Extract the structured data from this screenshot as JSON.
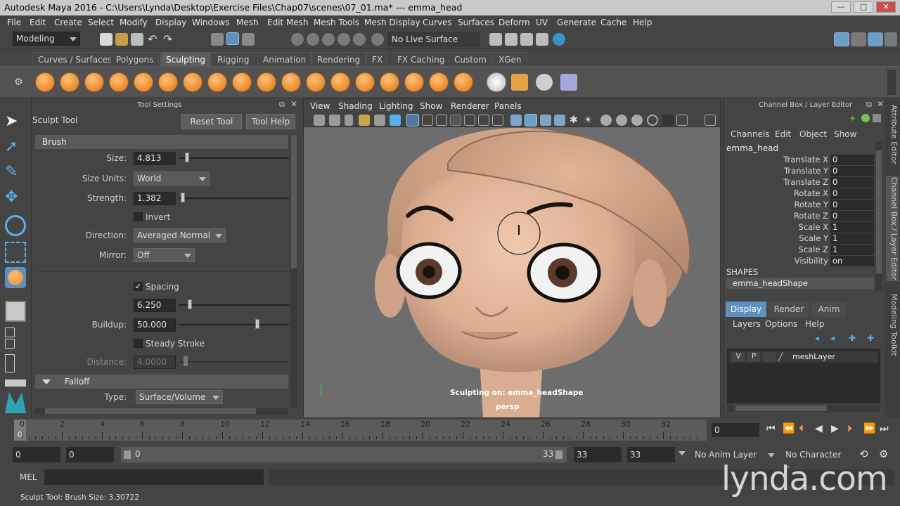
{
  "titlebar": {
    "title": "Autodesk Maya 2016 - C:\\Users\\Lynda\\Desktop\\Exercise Files\\Chap07\\scenes\\07_01.ma*  ---  emma_head",
    "min": "—",
    "max": "□",
    "close": "✕"
  },
  "menubar": [
    "File",
    "Edit",
    "Create",
    "Select",
    "Modify",
    "Display",
    "Windows",
    "Mesh",
    "Edit Mesh",
    "Mesh Tools",
    "Mesh Display",
    "Curves",
    "Surfaces",
    "Deform",
    "UV",
    "Generate",
    "Cache",
    "Help"
  ],
  "statusline": {
    "menuset": "Modeling",
    "live_surface": "No Live Surface"
  },
  "shelf_tabs": [
    "Curves / Surfaces",
    "Polygons",
    "Sculpting",
    "Rigging",
    "Animation",
    "Rendering",
    "FX",
    "FX Caching",
    "Custom",
    "XGen"
  ],
  "shelf_active": "Sculpting",
  "tool_settings": {
    "panel_title": "Tool Settings",
    "tool_name": "Sculpt Tool",
    "reset_label": "Reset Tool",
    "help_label": "Tool Help",
    "brush_section": "Brush",
    "size_label": "Size:",
    "size_value": "4.813",
    "size_units_label": "Size Units:",
    "size_units_value": "World",
    "strength_label": "Strength:",
    "strength_value": "1.382",
    "invert_label": "Invert",
    "direction_label": "Direction:",
    "direction_value": "Averaged Normal",
    "mirror_label": "Mirror:",
    "mirror_value": "Off",
    "spacing_label": "Spacing",
    "spacing_value": "6.250",
    "buildup_label": "Buildup:",
    "buildup_value": "50.000",
    "steady_label": "Steady Stroke",
    "distance_label": "Distance:",
    "distance_value": "4.0000",
    "falloff_section": "Falloff",
    "type_label": "Type:",
    "type_value": "Surface/Volume"
  },
  "viewport": {
    "menus": [
      "View",
      "Shading",
      "Lighting",
      "Show",
      "Renderer",
      "Panels"
    ],
    "hud_sculpt": "Sculpting on: emma_headShape",
    "camera": "persp"
  },
  "channel_box": {
    "panel_title": "Channel Box / Layer Editor",
    "menus": [
      "Channels",
      "Edit",
      "Object",
      "Show"
    ],
    "object_name": "emma_head",
    "attributes": [
      {
        "name": "Translate X",
        "value": "0"
      },
      {
        "name": "Translate Y",
        "value": "0"
      },
      {
        "name": "Translate Z",
        "value": "0"
      },
      {
        "name": "Rotate X",
        "value": "0"
      },
      {
        "name": "Rotate Y",
        "value": "0"
      },
      {
        "name": "Rotate Z",
        "value": "0"
      },
      {
        "name": "Scale X",
        "value": "1"
      },
      {
        "name": "Scale Y",
        "value": "1"
      },
      {
        "name": "Scale Z",
        "value": "1"
      },
      {
        "name": "Visibility",
        "value": "on"
      }
    ],
    "shapes_label": "SHAPES",
    "shape_name": "emma_headShape",
    "layer_tabs": [
      "Display",
      "Render",
      "Anim"
    ],
    "layer_menus": [
      "Layers",
      "Options",
      "Help"
    ],
    "layer": {
      "v": "V",
      "p": "P",
      "name": "meshLayer"
    }
  },
  "side_tabs": [
    "Attribute Editor",
    "Channel Box / Layer Editor",
    "Modeling Toolkit"
  ],
  "timeline": {
    "ticks": [
      "0",
      "2",
      "4",
      "6",
      "8",
      "10",
      "12",
      "14",
      "16",
      "18",
      "20",
      "22",
      "24",
      "26",
      "28",
      "30",
      "32"
    ],
    "start_label": "0",
    "current_frame": "0"
  },
  "range": {
    "start": "0",
    "anim_start": "0",
    "range_start": "0",
    "range_end": "33",
    "anim_end": "33",
    "end": "33",
    "anim_layer": "No Anim Layer",
    "char_set": "No Character Set"
  },
  "cmdline": {
    "label": "MEL"
  },
  "helpline": {
    "text": "Sculpt Tool: Brush Size: 3.30722"
  },
  "watermark": "lynda.com"
}
